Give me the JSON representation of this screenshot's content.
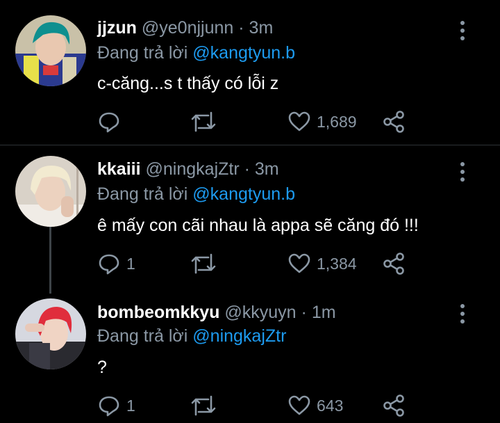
{
  "tweets": [
    {
      "name": "jjzun",
      "handle": "@ye0njjunn",
      "dot": "·",
      "time": "3m",
      "reply_prefix": "Đang trả lời ",
      "reply_to": "@kangtyun.b",
      "text": "c-căng...s t thấy có lỗi z",
      "replies": "",
      "retweets": "",
      "likes": "1,689"
    },
    {
      "name": "kkaiii",
      "handle": "@ningkajZtr",
      "dot": "·",
      "time": "3m",
      "reply_prefix": "Đang trả lời ",
      "reply_to": "@kangtyun.b",
      "text": "ê mấy con cãi nhau là appa sẽ căng đó !!!",
      "replies": "1",
      "retweets": "",
      "likes": "1,384"
    },
    {
      "name": "bombeomkkyu",
      "handle": "@kkyuyn",
      "dot": "·",
      "time": "1m",
      "reply_prefix": "Đang trả lời ",
      "reply_to": "@ningkajZtr",
      "text": "?",
      "replies": "1",
      "retweets": "",
      "likes": "643"
    }
  ],
  "icons": {
    "reply": "reply-icon",
    "retweet": "retweet-icon",
    "like": "heart-icon",
    "share": "share-icon",
    "more": "more-vertical-icon"
  },
  "colors": {
    "background": "#000000",
    "text": "#ffffff",
    "muted": "#8b98a5",
    "mention": "#1d9bf0",
    "divider": "#2f3336"
  }
}
